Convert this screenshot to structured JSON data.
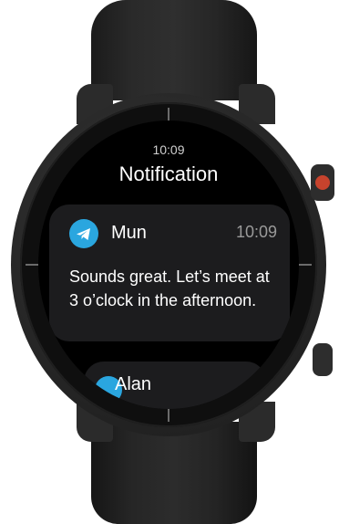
{
  "colors": {
    "accent": "#2aa6df",
    "crown_accent": "#c7432d",
    "screen": "#000000",
    "card": "#1c1c1e"
  },
  "status": {
    "time": "10:09"
  },
  "header": {
    "title": "Notification"
  },
  "notifications": [
    {
      "app_icon": "telegram-icon",
      "sender": "Mun",
      "time": "10:09",
      "message": "Sounds great. Let’s meet at 3 o’clock in the afternoon."
    },
    {
      "app_icon": "telegram-icon",
      "sender": "Alan"
    }
  ]
}
